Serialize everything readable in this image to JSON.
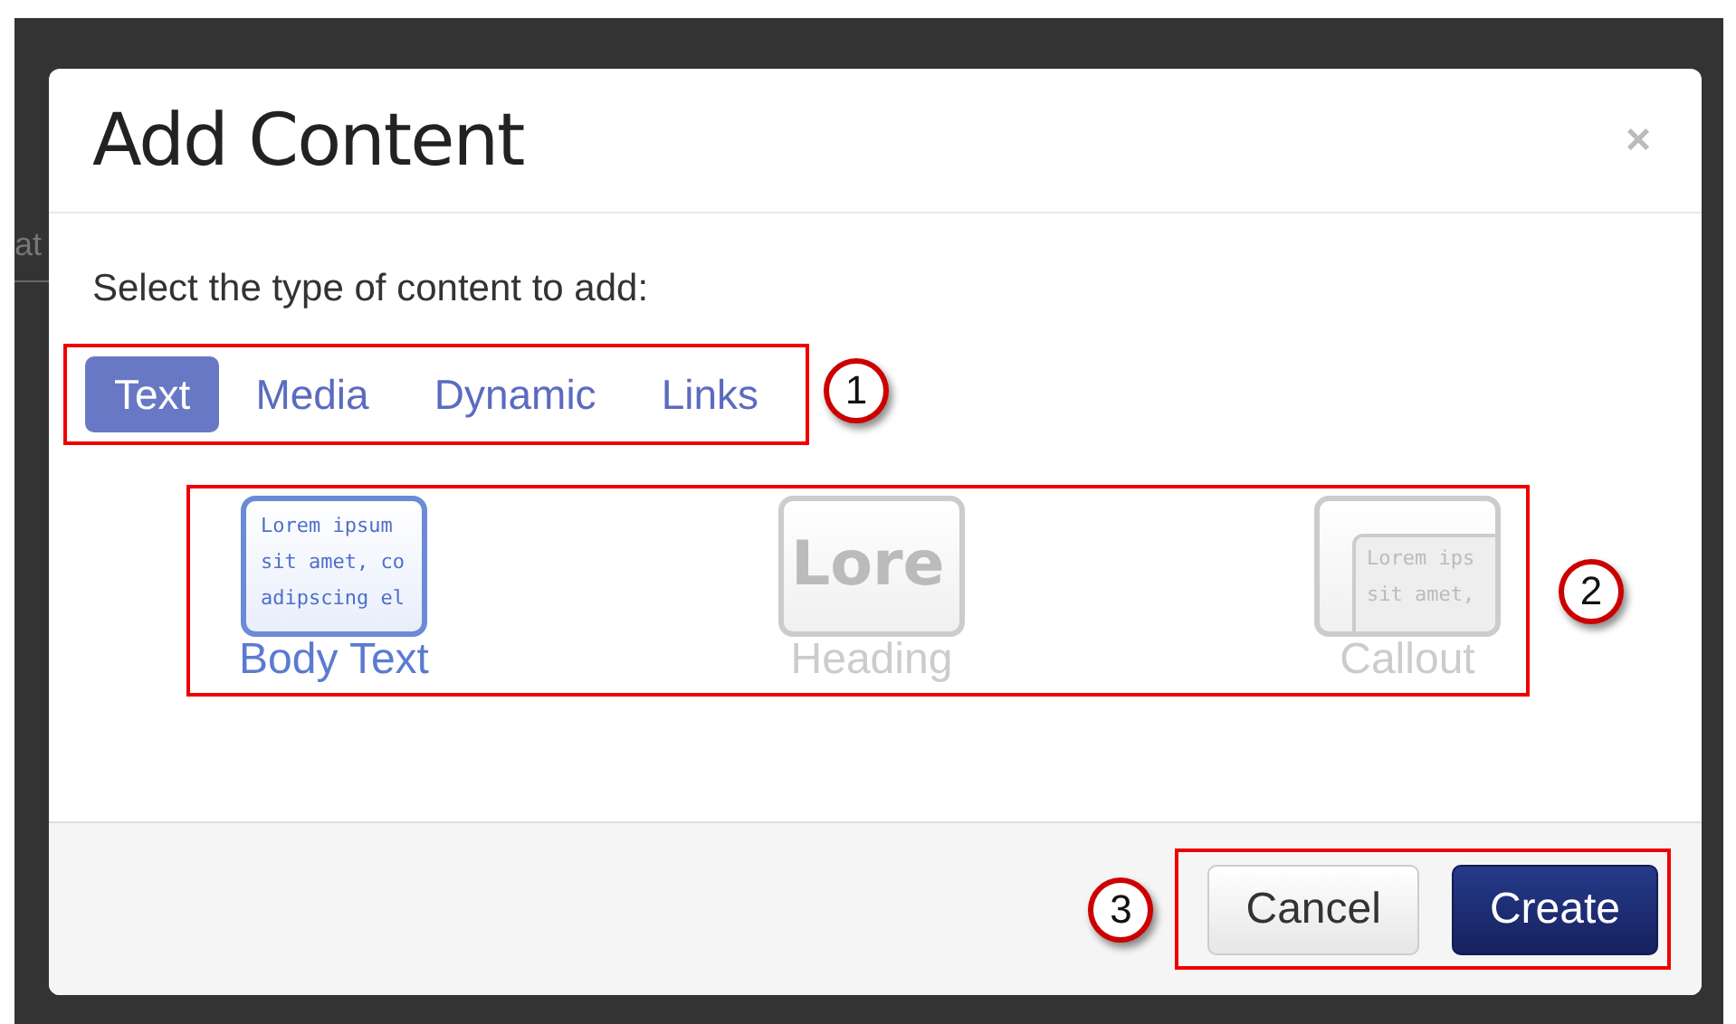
{
  "background": {
    "side_text": "at"
  },
  "dialog": {
    "title": "Add Content",
    "close": "×",
    "prompt": "Select the type of content to add:"
  },
  "tabs": {
    "callout": "1",
    "items": [
      {
        "label": "Text",
        "selected": true
      },
      {
        "label": "Media",
        "selected": false
      },
      {
        "label": "Dynamic",
        "selected": false
      },
      {
        "label": "Links",
        "selected": false
      }
    ]
  },
  "content_types": {
    "callout": "2",
    "items": [
      {
        "kind": "body",
        "label": "Body Text",
        "selected": true,
        "preview": [
          "Lorem ipsum",
          "sit amet, co",
          "adipscing el"
        ]
      },
      {
        "kind": "heading",
        "label": "Heading",
        "selected": false,
        "preview": [
          "Lore"
        ]
      },
      {
        "kind": "callout",
        "label": "Callout",
        "selected": false,
        "preview": [
          "Lorem ips",
          "sit amet,"
        ]
      }
    ]
  },
  "footer": {
    "callout": "3",
    "buttons": [
      {
        "label": "Cancel",
        "kind": "secondary"
      },
      {
        "label": "Create",
        "kind": "primary"
      }
    ]
  }
}
